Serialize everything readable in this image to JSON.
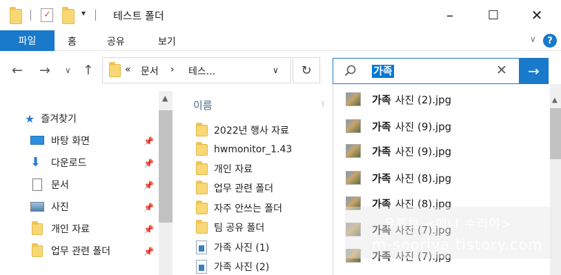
{
  "window": {
    "title": "테스트 폴더",
    "controls": {
      "minimize": "–",
      "maximize": "☐",
      "close": "✕"
    },
    "qat_dropdown": "▾"
  },
  "ribbon": {
    "tabs": [
      "파일",
      "홈",
      "공유",
      "보기"
    ],
    "collapse_chevron": "∨",
    "help": "?"
  },
  "nav": {
    "back": "←",
    "forward": "→",
    "recent": "∨",
    "up": "↑",
    "refresh": "↻",
    "address": {
      "overflow": "«",
      "crumb1": "문서",
      "separator": "›",
      "crumb2": "테스...",
      "dropdown": "∨"
    }
  },
  "search": {
    "icon": "search-icon",
    "value": "가족",
    "clear": "✕",
    "go": "→"
  },
  "nav_pane": {
    "quick_access": "즐겨찾기",
    "items": [
      {
        "label": "바탕 화면",
        "icon": "desktop-icon"
      },
      {
        "label": "다운로드",
        "icon": "download-icon"
      },
      {
        "label": "문서",
        "icon": "documents-icon"
      },
      {
        "label": "사진",
        "icon": "pictures-icon"
      },
      {
        "label": "개인 자료",
        "icon": "folder-icon"
      },
      {
        "label": "업무 관련 폴더",
        "icon": "folder-icon"
      }
    ]
  },
  "file_list": {
    "column_name": "이름",
    "items": [
      {
        "label": "2022년 행사 자료",
        "type": "folder"
      },
      {
        "label": "hwmonitor_1.43",
        "type": "folder"
      },
      {
        "label": "개인 자료",
        "type": "folder"
      },
      {
        "label": "업무 관련 폴더",
        "type": "folder"
      },
      {
        "label": "자주 안쓰는 폴더",
        "type": "folder"
      },
      {
        "label": "팀 공유 폴더",
        "type": "folder"
      },
      {
        "label": "가족 사진 (1)",
        "type": "image"
      },
      {
        "label": "가족 사진 (2)",
        "type": "image"
      }
    ]
  },
  "suggestions": [
    {
      "match": "가족",
      "rest": "사진 (2).jpg"
    },
    {
      "match": "가족",
      "rest": "사진 (9).jpg"
    },
    {
      "match": "가족",
      "rest": "사진 (9).jpg"
    },
    {
      "match": "가족",
      "rest": "사진 (8).jpg"
    },
    {
      "match": "가족",
      "rest": "사진 (8).jpg"
    },
    {
      "match": "가족",
      "rest": "사진 (7).jpg"
    },
    {
      "match": "가족",
      "rest": "사진 (7).jpg"
    }
  ],
  "watermark": {
    "line1": "유튜브 <매냐 수리야>",
    "line2": "m-sooriya.tistory.com"
  }
}
